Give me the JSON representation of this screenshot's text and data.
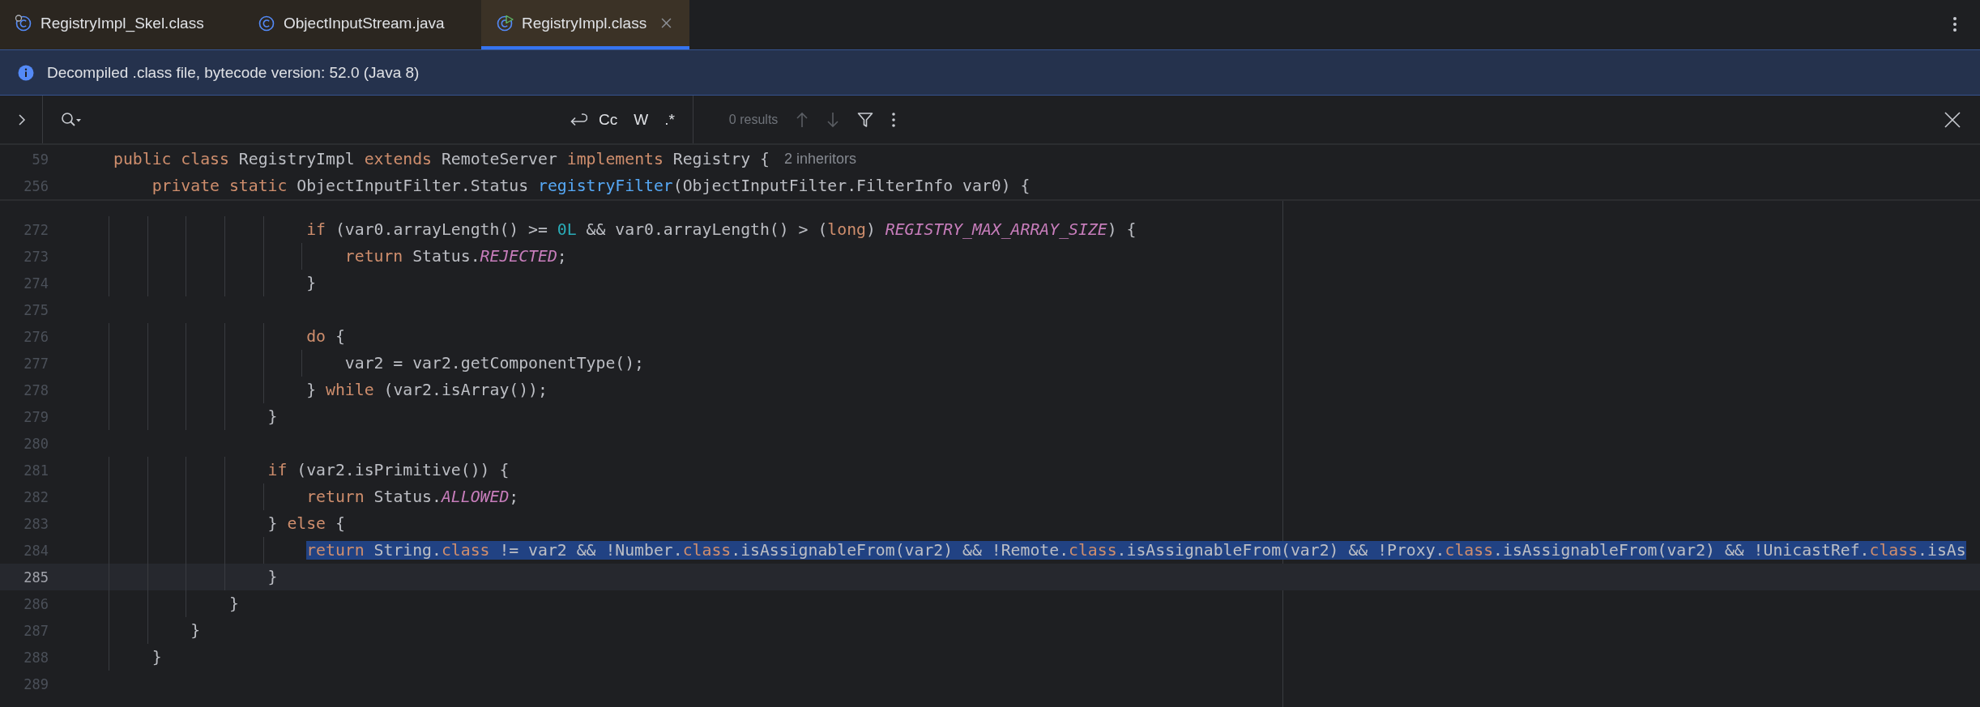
{
  "tabs": [
    {
      "label": "RegistryImpl_Skel.class",
      "kind": "linked",
      "selected": false
    },
    {
      "label": "ObjectInputStream.java",
      "kind": "plain",
      "selected": false
    },
    {
      "label": "RegistryImpl.class",
      "kind": "runnable",
      "selected": true
    }
  ],
  "banner": {
    "text": "Decompiled .class file, bytecode version: 52.0 (Java 8)"
  },
  "search": {
    "options": [
      {
        "label": "Cc",
        "selected": false
      },
      {
        "label": "W",
        "selected": false
      },
      {
        "label": ".*",
        "selected": false
      }
    ],
    "results": "0 results"
  },
  "sticky_lines": [
    {
      "number": "59",
      "tokens": [
        {
          "kind": "kw",
          "text": "public class"
        },
        {
          "kind": "plain",
          "text": " RegistryImpl "
        },
        {
          "kind": "kw",
          "text": "extends"
        },
        {
          "kind": "plain",
          "text": " RemoteServer "
        },
        {
          "kind": "kw",
          "text": "implements"
        },
        {
          "kind": "plain",
          "text": " Registry {"
        }
      ],
      "hint": "2 inheritors"
    },
    {
      "number": "256",
      "tokens": [
        {
          "kind": "kw",
          "text": "    private static"
        },
        {
          "kind": "plain",
          "text": " ObjectInputFilter.Status "
        },
        {
          "kind": "fn",
          "text": "registryFilter"
        },
        {
          "kind": "plain",
          "text": "(ObjectInputFilter.FilterInfo var0) {"
        }
      ]
    }
  ],
  "lines": [
    {
      "number": "272",
      "current": false,
      "selected": false,
      "tokens": [
        {
          "kind": "kw",
          "text": "                    if"
        },
        {
          "kind": "plain",
          "text": " (var0.arrayLength() >= "
        },
        {
          "kind": "num",
          "text": "0L"
        },
        {
          "kind": "plain",
          "text": " && var0.arrayLength() > ("
        },
        {
          "kind": "kw",
          "text": "long"
        },
        {
          "kind": "plain",
          "text": ") "
        },
        {
          "kind": "const",
          "text": "REGISTRY_MAX_ARRAY_SIZE"
        },
        {
          "kind": "plain",
          "text": ") {"
        }
      ]
    },
    {
      "number": "273",
      "current": false,
      "selected": false,
      "tokens": [
        {
          "kind": "kw",
          "text": "                        return"
        },
        {
          "kind": "plain",
          "text": " Status."
        },
        {
          "kind": "const",
          "text": "REJECTED"
        },
        {
          "kind": "plain",
          "text": ";"
        }
      ]
    },
    {
      "number": "274",
      "current": false,
      "selected": false,
      "tokens": [
        {
          "kind": "plain",
          "text": "                    }"
        }
      ]
    },
    {
      "number": "275",
      "current": false,
      "selected": false
    },
    {
      "number": "276",
      "current": false,
      "selected": false,
      "tokens": [
        {
          "kind": "kw",
          "text": "                    do"
        },
        {
          "kind": "plain",
          "text": " {"
        }
      ]
    },
    {
      "number": "277",
      "current": false,
      "selected": false,
      "tokens": [
        {
          "kind": "plain",
          "text": "                        var2 = var2.getComponentType();"
        }
      ]
    },
    {
      "number": "278",
      "current": false,
      "selected": false,
      "tokens": [
        {
          "kind": "plain",
          "text": "                    } "
        },
        {
          "kind": "kw",
          "text": "while"
        },
        {
          "kind": "plain",
          "text": " (var2.isArray());"
        }
      ]
    },
    {
      "number": "279",
      "current": false,
      "selected": false,
      "tokens": [
        {
          "kind": "plain",
          "text": "                }"
        }
      ]
    },
    {
      "number": "280",
      "current": false,
      "selected": false
    },
    {
      "number": "281",
      "current": false,
      "selected": false,
      "tokens": [
        {
          "kind": "kw",
          "text": "                if"
        },
        {
          "kind": "plain",
          "text": " (var2.isPrimitive()) {"
        }
      ]
    },
    {
      "number": "282",
      "current": false,
      "selected": false,
      "tokens": [
        {
          "kind": "kw",
          "text": "                    return"
        },
        {
          "kind": "plain",
          "text": " Status."
        },
        {
          "kind": "const",
          "text": "ALLOWED"
        },
        {
          "kind": "plain",
          "text": ";"
        }
      ]
    },
    {
      "number": "283",
      "current": false,
      "selected": false,
      "tokens": [
        {
          "kind": "plain",
          "text": "                } "
        },
        {
          "kind": "kw",
          "text": "else"
        },
        {
          "kind": "plain",
          "text": " {"
        }
      ]
    },
    {
      "number": "284",
      "current": false,
      "selected": true,
      "tokens": [
        {
          "kind": "kw",
          "text": "                    return"
        },
        {
          "kind": "plain",
          "text": " String."
        },
        {
          "kind": "kw",
          "text": "class"
        },
        {
          "kind": "plain",
          "text": " != var2 && !Number."
        },
        {
          "kind": "kw",
          "text": "class"
        },
        {
          "kind": "plain",
          "text": ".isAssignableFrom(var2) && !Remote."
        },
        {
          "kind": "kw",
          "text": "class"
        },
        {
          "kind": "plain",
          "text": ".isAssignableFrom(var2) && !Proxy."
        },
        {
          "kind": "kw",
          "text": "class"
        },
        {
          "kind": "plain",
          "text": ".isAssignableFrom(var2) && !UnicastRef."
        },
        {
          "kind": "kw",
          "text": "class"
        },
        {
          "kind": "plain",
          "text": ".isAs"
        }
      ]
    },
    {
      "number": "285",
      "current": true,
      "selected": false,
      "tokens": [
        {
          "kind": "plain",
          "text": "                }"
        }
      ]
    },
    {
      "number": "286",
      "current": false,
      "selected": false,
      "tokens": [
        {
          "kind": "plain",
          "text": "            }"
        }
      ]
    },
    {
      "number": "287",
      "current": false,
      "selected": false,
      "tokens": [
        {
          "kind": "plain",
          "text": "        }"
        }
      ]
    },
    {
      "number": "288",
      "current": false,
      "selected": false,
      "tokens": [
        {
          "kind": "plain",
          "text": "    }"
        }
      ]
    },
    {
      "number": "289",
      "current": false,
      "selected": false
    }
  ]
}
